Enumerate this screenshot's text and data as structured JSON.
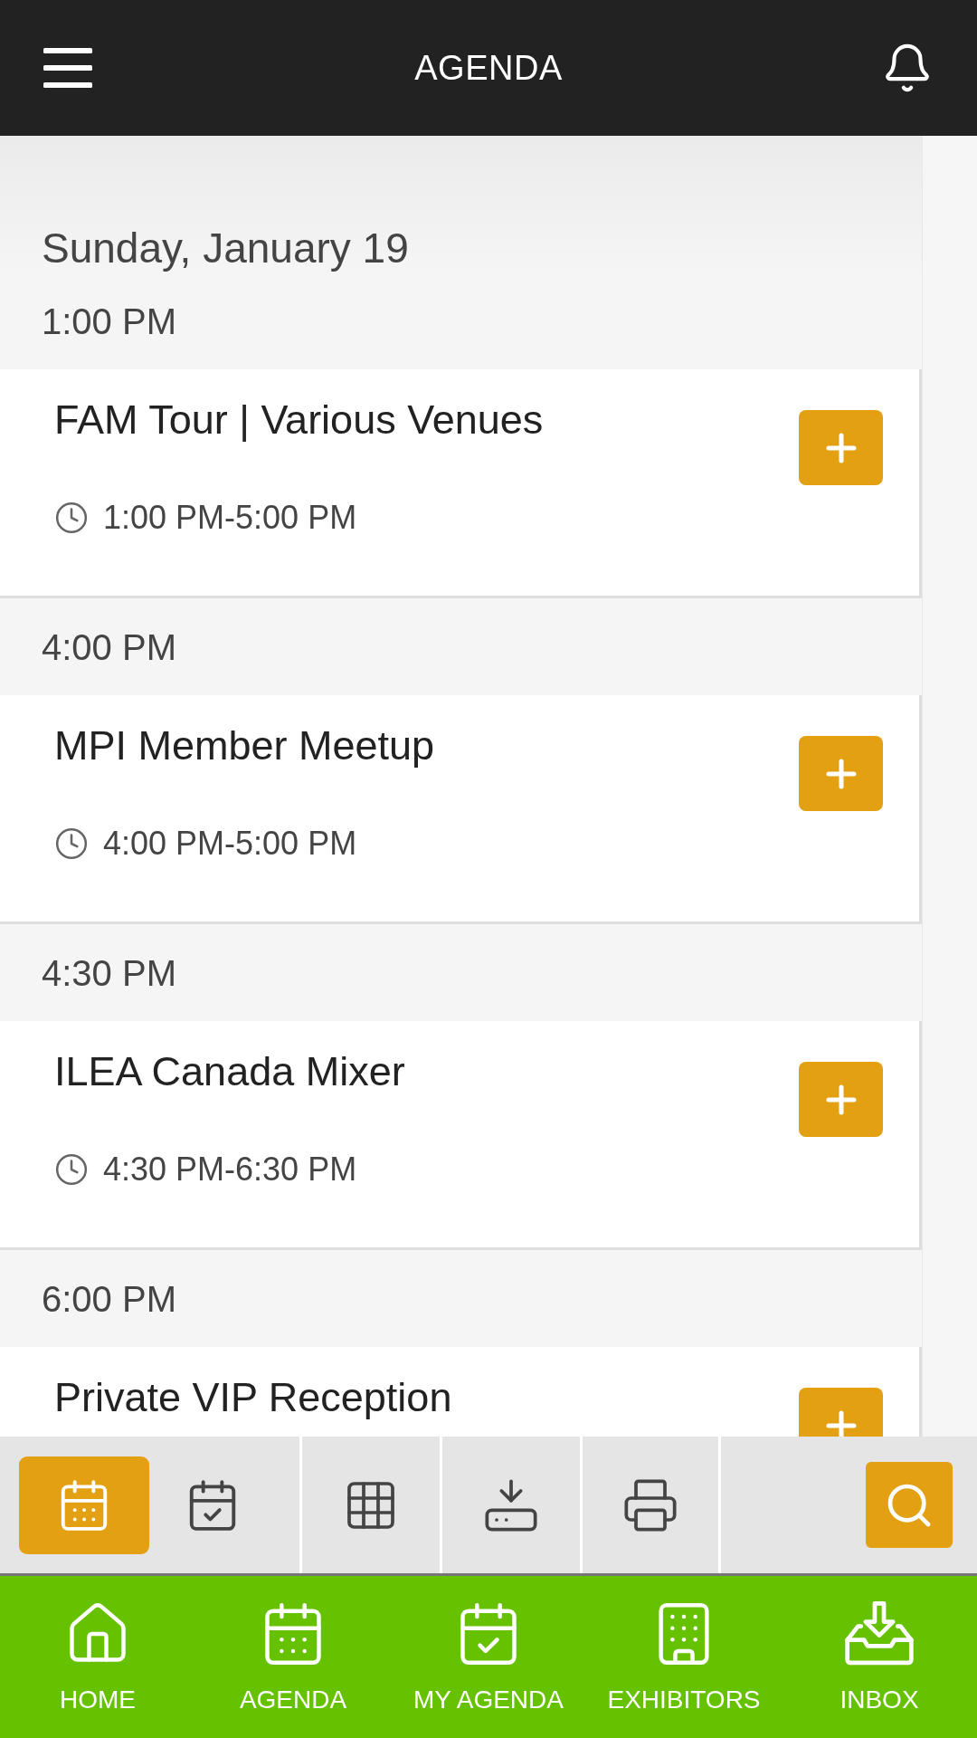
{
  "top_bar": {
    "title": "AGENDA"
  },
  "date": "Sunday, January 19",
  "time_slots": [
    {
      "time": "1:00 PM",
      "sessions": [
        {
          "title": "FAM Tour | Various Venues",
          "time_range": "1:00 PM-5:00 PM"
        }
      ]
    },
    {
      "time": "4:00 PM",
      "sessions": [
        {
          "title": "MPI Member Meetup",
          "time_range": "4:00 PM-5:00 PM"
        }
      ]
    },
    {
      "time": "4:30 PM",
      "sessions": [
        {
          "title": "ILEA Canada Mixer",
          "time_range": "4:30 PM-6:30 PM"
        }
      ]
    },
    {
      "time": "6:00 PM",
      "sessions": [
        {
          "title": "Private VIP Reception"
        }
      ]
    }
  ],
  "toolbar": {
    "views": [
      {
        "selected": true
      },
      {
        "selected": false
      }
    ]
  },
  "bottom_nav": [
    {
      "label": "HOME"
    },
    {
      "label": "AGENDA"
    },
    {
      "label": "MY AGENDA"
    },
    {
      "label": "EXHIBITORS"
    },
    {
      "label": "INBOX"
    }
  ]
}
